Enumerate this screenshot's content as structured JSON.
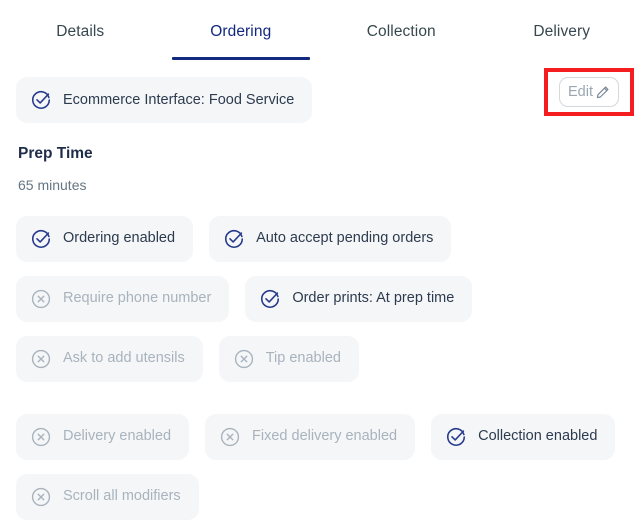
{
  "tabs": [
    {
      "label": "Details",
      "active": false
    },
    {
      "label": "Ordering",
      "active": true
    },
    {
      "label": "Collection",
      "active": false
    },
    {
      "label": "Delivery",
      "active": false
    }
  ],
  "identity_chip": {
    "label": "Ecommerce Interface: Food Service",
    "icon": "check-circle-icon",
    "enabled": true
  },
  "edit_button": {
    "label": "Edit",
    "icon": "pencil-icon",
    "highlight_color": "#f41e21"
  },
  "prep_time": {
    "title": "Prep Time",
    "value": "65 minutes"
  },
  "setting_rows": [
    [
      {
        "label": "Ordering enabled",
        "enabled": true
      },
      {
        "label": "Auto accept pending orders",
        "enabled": true
      }
    ],
    [
      {
        "label": "Require phone number",
        "enabled": false
      },
      {
        "label": "Order prints: At prep time",
        "enabled": true
      }
    ],
    [
      {
        "label": "Ask to add utensils",
        "enabled": false
      },
      {
        "label": "Tip enabled",
        "enabled": false
      }
    ],
    [
      {
        "label": "Delivery enabled",
        "enabled": false
      },
      {
        "label": "Fixed delivery enabled",
        "enabled": false
      },
      {
        "label": "Collection enabled",
        "enabled": true
      }
    ],
    [
      {
        "label": "Scroll all modifiers",
        "enabled": false
      }
    ]
  ],
  "colors": {
    "accent": "#12297e",
    "chip_bg": "#f5f6f8",
    "label_on": "#2d3b4e",
    "label_off": "#a8b3bd",
    "icon_on": "#26398c",
    "icon_off": "#a8b3bd"
  }
}
